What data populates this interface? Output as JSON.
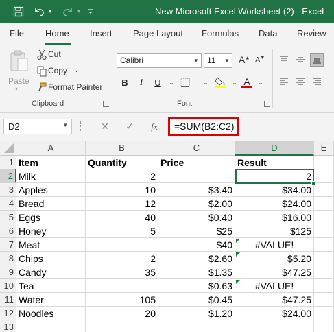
{
  "titlebar": {
    "title": "New Microsoft Excel Worksheet (2)  -  Excel",
    "icons": [
      "save-icon",
      "undo-icon",
      "undo-dropdown-icon",
      "redo-icon",
      "redo-dropdown-icon",
      "customize-qat-icon"
    ]
  },
  "tabs": {
    "file": "File",
    "home": "Home",
    "insert": "Insert",
    "page_layout": "Page Layout",
    "formulas": "Formulas",
    "data": "Data",
    "review": "Review"
  },
  "ribbon": {
    "paste": "Paste",
    "cut": "Cut",
    "copy": "Copy",
    "format_painter": "Format Painter",
    "clipboard_label": "Clipboard",
    "font_name": "Calibri",
    "font_size": "11",
    "bold": "B",
    "italic": "I",
    "underline": "U",
    "font_color_letter": "A",
    "font_label": "Font",
    "highlight_color": "#ffff00",
    "font_color": "#e00000"
  },
  "formula_bar": {
    "name_box": "D2",
    "fx": "fx",
    "formula": "=SUM(B2:C2)"
  },
  "grid": {
    "columns": [
      "A",
      "B",
      "C",
      "D",
      "E"
    ],
    "selected_column": "D",
    "selected_row": "2",
    "rows": [
      {
        "n": "1",
        "a": "Item",
        "b": "Quantity",
        "c": "Price",
        "d": "Result"
      },
      {
        "n": "2",
        "a": "Milk",
        "b": "2",
        "c": "",
        "d": "2"
      },
      {
        "n": "3",
        "a": "Apples",
        "b": "10",
        "c": "$3.40",
        "d": "$34.00"
      },
      {
        "n": "4",
        "a": "Bread",
        "b": "12",
        "c": "$2.00",
        "d": "$24.00"
      },
      {
        "n": "5",
        "a": "Eggs",
        "b": "40",
        "c": "$0.40",
        "d": "$16.00"
      },
      {
        "n": "6",
        "a": "Honey",
        "b": "5",
        "c": "$25",
        "d": "$125"
      },
      {
        "n": "7",
        "a": "Meat",
        "b": "",
        "c": "$40",
        "d": "#VALUE!"
      },
      {
        "n": "8",
        "a": "Chips",
        "b": "2",
        "c": "$2.60",
        "d": "$5.20"
      },
      {
        "n": "9",
        "a": "Candy",
        "b": "35",
        "c": "$1.35",
        "d": "$47.25"
      },
      {
        "n": "10",
        "a": "Tea",
        "b": "",
        "c": "$0.63",
        "d": "#VALUE!"
      },
      {
        "n": "11",
        "a": "Water",
        "b": "105",
        "c": "$0.45",
        "d": "$47.25"
      },
      {
        "n": "12",
        "a": "Noodles",
        "b": "20",
        "c": "$1.20",
        "d": "$24.00"
      },
      {
        "n": "13",
        "a": "",
        "b": "",
        "c": "",
        "d": ""
      }
    ]
  },
  "colors": {
    "excel_green": "#217346",
    "highlight_box": "#e00000"
  }
}
